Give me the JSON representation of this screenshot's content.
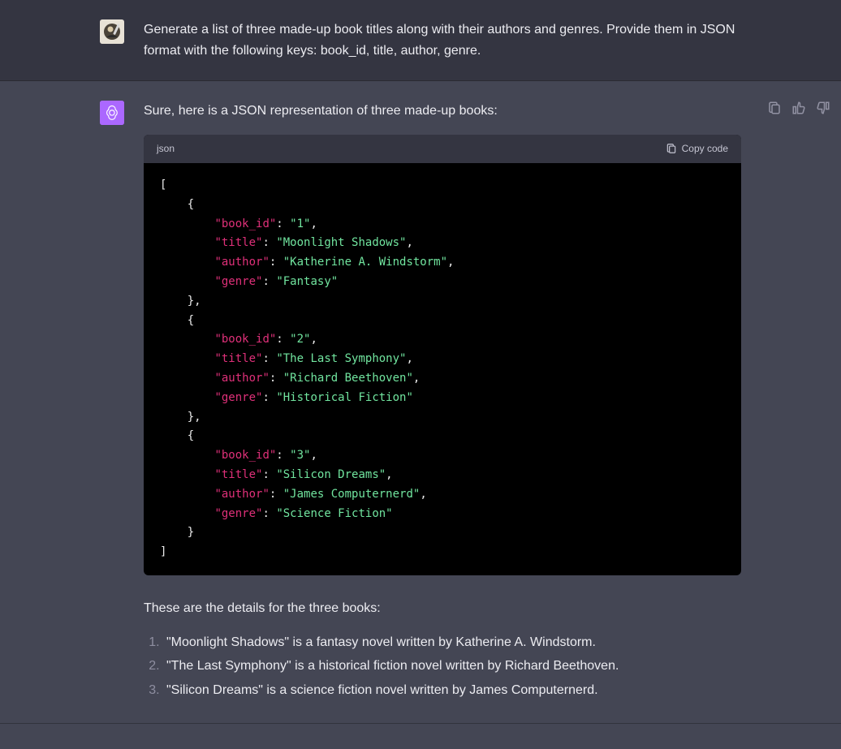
{
  "user": {
    "prompt": "Generate a list of three made-up book titles along with their authors and genres. Provide them in JSON format with the following keys: book_id, title, author, genre."
  },
  "assistant": {
    "intro": "Sure, here is a JSON representation of three made-up books:",
    "code_lang": "json",
    "copy_label": "Copy code",
    "books": [
      {
        "book_id": "1",
        "title": "Moonlight Shadows",
        "author": "Katherine A. Windstorm",
        "genre": "Fantasy"
      },
      {
        "book_id": "2",
        "title": "The Last Symphony",
        "author": "Richard Beethoven",
        "genre": "Historical Fiction"
      },
      {
        "book_id": "3",
        "title": "Silicon Dreams",
        "author": "James Computernerd",
        "genre": "Science Fiction"
      }
    ],
    "outro": "These are the details for the three books:",
    "summary": [
      "\"Moonlight Shadows\" is a fantasy novel written by Katherine A. Windstorm.",
      "\"The Last Symphony\" is a historical fiction novel written by Richard Beethoven.",
      "\"Silicon Dreams\" is a science fiction novel written by James Computernerd."
    ]
  }
}
